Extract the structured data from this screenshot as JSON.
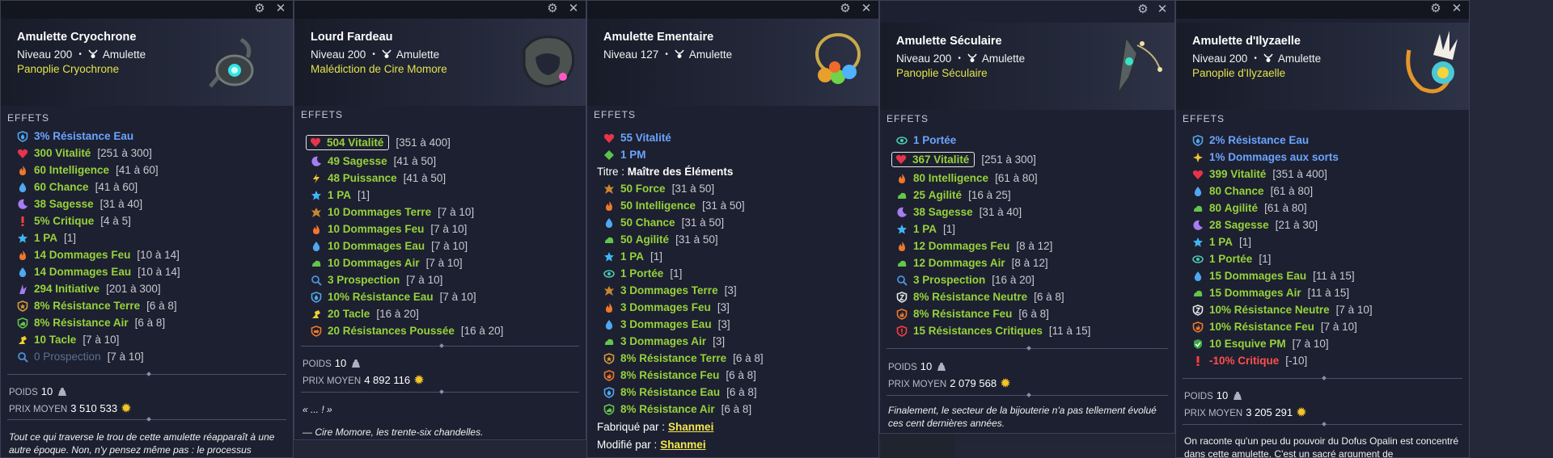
{
  "colors": {
    "set_yellow": "#e3e34b",
    "stat_green": "#96d23c",
    "stat_blue": "#6aa4ff",
    "kamas": "#f5c528",
    "negative": "#ff4e4e"
  },
  "labels": {
    "effets": "EFFETS",
    "poids": "POIDS",
    "prix_moyen": "PRIX MOYEN",
    "type": "Amulette",
    "dot": "•"
  },
  "panels": [
    {
      "title": "Amulette Cryochrone",
      "level": "Niveau 200",
      "set": "Panoplie Cryochrone",
      "effects": [
        {
          "icon": "water-res",
          "value": "3%",
          "name": "Résistance Eau",
          "range": "",
          "style": "blue"
        },
        {
          "icon": "heart",
          "value": "300",
          "name": "Vitalité",
          "range": "[251 à 300]"
        },
        {
          "icon": "fire",
          "value": "60",
          "name": "Intelligence",
          "range": "[41 à 60]"
        },
        {
          "icon": "drop",
          "value": "60",
          "name": "Chance",
          "range": "[41 à 60]"
        },
        {
          "icon": "moon",
          "value": "38",
          "name": "Sagesse",
          "range": "[31 à 40]"
        },
        {
          "icon": "crit",
          "value": "5%",
          "name": "Critique",
          "range": "[4 à 5]"
        },
        {
          "icon": "star",
          "value": "1",
          "name": "PA",
          "range": "[1]"
        },
        {
          "icon": "fire",
          "value": "14",
          "name": "Dommages Feu",
          "range": "[10 à 14]"
        },
        {
          "icon": "drop",
          "value": "14",
          "name": "Dommages Eau",
          "range": "[10 à 14]"
        },
        {
          "icon": "initiative",
          "value": "294",
          "name": "Initiative",
          "range": "[201 à 300]"
        },
        {
          "icon": "earth-res",
          "value": "8%",
          "name": "Résistance Terre",
          "range": "[6 à 8]"
        },
        {
          "icon": "air-res",
          "value": "8%",
          "name": "Résistance Air",
          "range": "[6 à 8]"
        },
        {
          "icon": "tackle",
          "value": "10",
          "name": "Tacle",
          "range": "[7 à 10]"
        },
        {
          "icon": "prospection",
          "value": "0",
          "name": "Prospection",
          "range": "[7 à 10]",
          "style": "dim"
        }
      ],
      "weight": "10",
      "price": "3 510 533",
      "description": "Tout ce qui traverse le trou de cette amulette réapparaît à une autre époque. Non, n'y pensez même pas : le processus"
    },
    {
      "title": "Lourd Fardeau",
      "level": "Niveau 200",
      "set": "Malédiction de Cire Momore",
      "effects": [
        {
          "icon": "heart",
          "value": "504",
          "name": "Vitalité",
          "range": "[351 à 400]",
          "framed": true
        },
        {
          "icon": "moon",
          "value": "49",
          "name": "Sagesse",
          "range": "[41 à 50]"
        },
        {
          "icon": "power",
          "value": "48",
          "name": "Puissance",
          "range": "[41 à 50]"
        },
        {
          "icon": "star",
          "value": "1",
          "name": "PA",
          "range": "[1]"
        },
        {
          "icon": "earth",
          "value": "10",
          "name": "Dommages Terre",
          "range": "[7 à 10]"
        },
        {
          "icon": "fire",
          "value": "10",
          "name": "Dommages Feu",
          "range": "[7 à 10]"
        },
        {
          "icon": "drop",
          "value": "10",
          "name": "Dommages Eau",
          "range": "[7 à 10]"
        },
        {
          "icon": "air",
          "value": "10",
          "name": "Dommages Air",
          "range": "[7 à 10]"
        },
        {
          "icon": "prospection",
          "value": "3",
          "name": "Prospection",
          "range": "[7 à 10]"
        },
        {
          "icon": "water-res",
          "value": "10%",
          "name": "Résistance Eau",
          "range": "[7 à 10]"
        },
        {
          "icon": "tackle",
          "value": "20",
          "name": "Tacle",
          "range": "[16 à 20]"
        },
        {
          "icon": "push-res",
          "value": "20",
          "name": "Résistances Poussée",
          "range": "[16 à 20]"
        }
      ],
      "weight": "10",
      "price": "4 892 116",
      "quote": "« ... ! »",
      "signature": "— Cire Momore, les trente-six chandelles."
    },
    {
      "title": "Amulette Ementaire",
      "level": "Niveau 127",
      "set": "",
      "effects": [
        {
          "icon": "heart",
          "value": "55",
          "name": "Vitalité",
          "range": "",
          "style": "blue"
        },
        {
          "icon": "pm",
          "value": "1",
          "name": "PM",
          "range": "",
          "style": "blue"
        },
        {
          "kind": "title",
          "label": "Titre :",
          "text": "Maître des Éléments"
        },
        {
          "icon": "earth",
          "value": "50",
          "name": "Force",
          "range": "[31 à 50]"
        },
        {
          "icon": "fire",
          "value": "50",
          "name": "Intelligence",
          "range": "[31 à 50]"
        },
        {
          "icon": "drop",
          "value": "50",
          "name": "Chance",
          "range": "[31 à 50]"
        },
        {
          "icon": "air",
          "value": "50",
          "name": "Agilité",
          "range": "[31 à 50]"
        },
        {
          "icon": "star",
          "value": "1",
          "name": "PA",
          "range": "[1]"
        },
        {
          "icon": "eye",
          "value": "1",
          "name": "Portée",
          "range": "[1]"
        },
        {
          "icon": "earth",
          "value": "3",
          "name": "Dommages Terre",
          "range": "[3]"
        },
        {
          "icon": "fire",
          "value": "3",
          "name": "Dommages Feu",
          "range": "[3]"
        },
        {
          "icon": "drop",
          "value": "3",
          "name": "Dommages Eau",
          "range": "[3]"
        },
        {
          "icon": "air",
          "value": "3",
          "name": "Dommages Air",
          "range": "[3]"
        },
        {
          "icon": "earth-res",
          "value": "8%",
          "name": "Résistance Terre",
          "range": "[6 à 8]"
        },
        {
          "icon": "fire-res",
          "value": "8%",
          "name": "Résistance Feu",
          "range": "[6 à 8]"
        },
        {
          "icon": "water-res",
          "value": "8%",
          "name": "Résistance Eau",
          "range": "[6 à 8]"
        },
        {
          "icon": "air-res",
          "value": "8%",
          "name": "Résistance Air",
          "range": "[6 à 8]"
        },
        {
          "kind": "link",
          "label": "Fabriqué par :",
          "text": "Shanmei"
        },
        {
          "kind": "link",
          "label": "Modifié par :",
          "text": "Shanmei"
        }
      ]
    },
    {
      "title": "Amulette Séculaire",
      "level": "Niveau 200",
      "set": "Panoplie Séculaire",
      "effects": [
        {
          "icon": "eye",
          "value": "1",
          "name": "Portée",
          "range": "",
          "style": "blue"
        },
        {
          "icon": "heart",
          "value": "367",
          "name": "Vitalité",
          "range": "[251 à 300]",
          "framed": true
        },
        {
          "icon": "fire",
          "value": "80",
          "name": "Intelligence",
          "range": "[61 à 80]"
        },
        {
          "icon": "air",
          "value": "25",
          "name": "Agilité",
          "range": "[16 à 25]"
        },
        {
          "icon": "moon",
          "value": "38",
          "name": "Sagesse",
          "range": "[31 à 40]"
        },
        {
          "icon": "star",
          "value": "1",
          "name": "PA",
          "range": "[1]"
        },
        {
          "icon": "fire",
          "value": "12",
          "name": "Dommages Feu",
          "range": "[8 à 12]"
        },
        {
          "icon": "air",
          "value": "12",
          "name": "Dommages Air",
          "range": "[8 à 12]"
        },
        {
          "icon": "prospection",
          "value": "3",
          "name": "Prospection",
          "range": "[16 à 20]"
        },
        {
          "icon": "neutral-res",
          "value": "8%",
          "name": "Résistance Neutre",
          "range": "[6 à 8]"
        },
        {
          "icon": "fire-res",
          "value": "8%",
          "name": "Résistance Feu",
          "range": "[6 à 8]"
        },
        {
          "icon": "crit-res",
          "value": "15",
          "name": "Résistances Critiques",
          "range": "[11 à 15]"
        }
      ],
      "weight": "10",
      "price": "2 079 568",
      "description": "Finalement, le secteur de la bijouterie n'a pas tellement évolué ces cent dernières années."
    },
    {
      "title": "Amulette d'Ilyzaelle",
      "level": "Niveau 200",
      "set": "Panoplie d'Ilyzaelle",
      "effects": [
        {
          "icon": "water-res",
          "value": "2%",
          "name": "Résistance Eau",
          "range": "",
          "style": "blue"
        },
        {
          "icon": "spell",
          "value": "1%",
          "name": "Dommages aux sorts",
          "range": "",
          "style": "blue"
        },
        {
          "icon": "heart",
          "value": "399",
          "name": "Vitalité",
          "range": "[351 à 400]"
        },
        {
          "icon": "drop",
          "value": "80",
          "name": "Chance",
          "range": "[61 à 80]"
        },
        {
          "icon": "air",
          "value": "80",
          "name": "Agilité",
          "range": "[61 à 80]"
        },
        {
          "icon": "moon",
          "value": "28",
          "name": "Sagesse",
          "range": "[21 à 30]"
        },
        {
          "icon": "star",
          "value": "1",
          "name": "PA",
          "range": "[1]"
        },
        {
          "icon": "eye",
          "value": "1",
          "name": "Portée",
          "range": "[1]"
        },
        {
          "icon": "drop",
          "value": "15",
          "name": "Dommages Eau",
          "range": "[11 à 15]"
        },
        {
          "icon": "air",
          "value": "15",
          "name": "Dommages Air",
          "range": "[11 à 15]"
        },
        {
          "icon": "neutral-res",
          "value": "10%",
          "name": "Résistance Neutre",
          "range": "[7 à 10]"
        },
        {
          "icon": "fire-res",
          "value": "10%",
          "name": "Résistance Feu",
          "range": "[7 à 10]"
        },
        {
          "icon": "dodge",
          "value": "10",
          "name": "Esquive PM",
          "range": "[7 à 10]"
        },
        {
          "icon": "crit",
          "value": "-10%",
          "name": "Critique",
          "range": "[-10]",
          "style": "red"
        }
      ],
      "weight": "10",
      "price": "3 205 291",
      "description": "On raconte qu'un peu du pouvoir du Dofus Opalin est concentré dans cette amulette. C'est un sacré argument de"
    }
  ]
}
